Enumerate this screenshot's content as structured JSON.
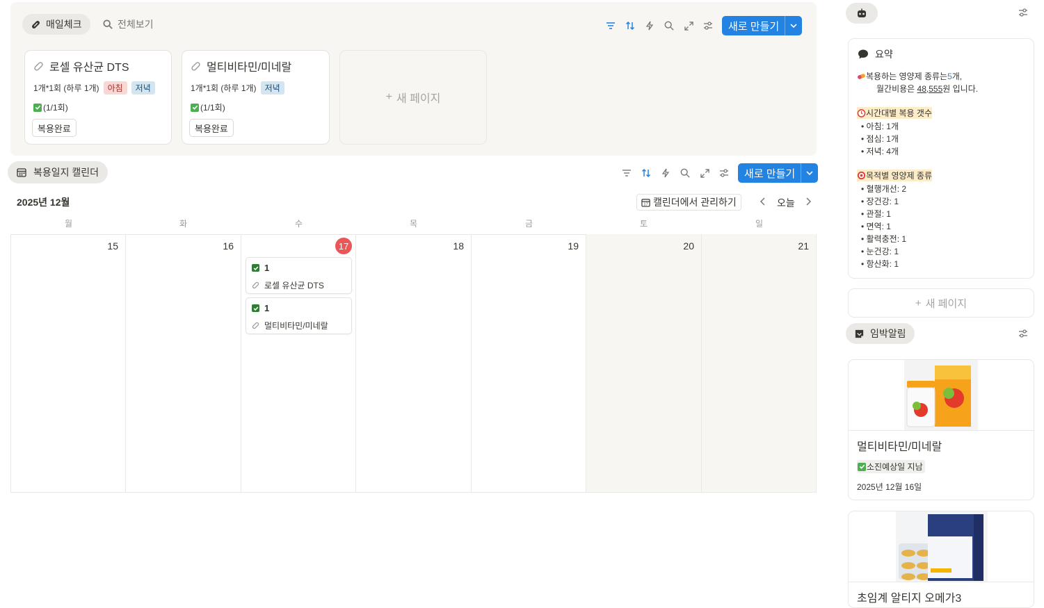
{
  "top_block": {
    "tabs": [
      {
        "label": "매일체크",
        "icon": "pill-icon"
      },
      {
        "label": "전체보기",
        "icon": "search-icon"
      }
    ],
    "new_button": "새로 만들기",
    "cards": [
      {
        "title": "로셀 유산균 DTS",
        "dose": "1개*1회 (하루 1개)",
        "tags": [
          "아침",
          "저녁"
        ],
        "status": "(1/1회)",
        "button": "복용완료"
      },
      {
        "title": "멀티비타민/미네랄",
        "dose": "1개*1회 (하루 1개)",
        "tags": [
          "저녁"
        ],
        "status": "(1/1회)",
        "button": "복용완료"
      }
    ],
    "new_page": "새 페이지"
  },
  "calendar": {
    "view_label": "복용일지 캘린더",
    "new_button": "새로 만들기",
    "month": "2025년 12월",
    "manage_button": "캘린더에서 관리하기",
    "today_button": "오늘",
    "weekdays": [
      "월",
      "화",
      "수",
      "목",
      "금",
      "토",
      "일"
    ],
    "days": [
      "15",
      "16",
      "17",
      "18",
      "19",
      "20",
      "21"
    ],
    "today": "17",
    "events": [
      {
        "count": "1",
        "name": "로셀 유산균 DTS"
      },
      {
        "count": "1",
        "name": "멀티비타민/미네랄"
      }
    ]
  },
  "summary": {
    "title": "요약",
    "line1_pre": "복용하는 영양제 종류는 ",
    "line1_num": "5",
    "line1_post": "개,",
    "line2_pre": "월간비용은 ",
    "line2_num": "48,555",
    "line2_post": "원 입니다.",
    "time_heading": "시간대별 복용 갯수",
    "time_items": [
      "아침: 1개",
      "점심: 1개",
      "저녁: 4개"
    ],
    "purpose_heading": "목적별 영양제 종류",
    "purpose_items": [
      "혈행개선: 2",
      "장건강: 1",
      "관절: 1",
      "면역: 1",
      "활력충전: 1",
      "눈건강: 1",
      "항산화: 1"
    ],
    "new_page": "새 페이지"
  },
  "alerts": {
    "title": "임박알림",
    "items": [
      {
        "name": "멀티비타민/미네랄",
        "status": "소진예상일 지남",
        "date": "2025년 12월 16일"
      },
      {
        "name": "초임계 알티지 오메가3"
      }
    ]
  },
  "colors": {
    "accent": "#2383e2",
    "today": "#eb5757",
    "weekend": "#f7f6f3"
  }
}
